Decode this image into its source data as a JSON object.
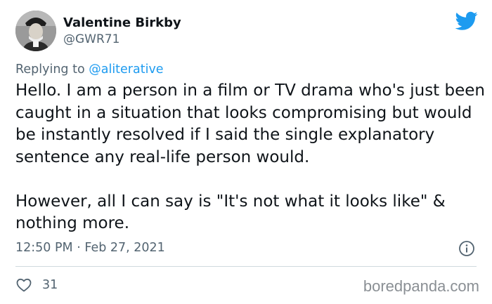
{
  "author": {
    "name": "Valentine Birkby",
    "handle": "@GWR71"
  },
  "reply": {
    "prefix": "Replying to ",
    "mention": "@aliterative"
  },
  "tweet": {
    "paragraphs": [
      "Hello. I am a person in a film or TV drama who's just been caught in a situation that looks compromising but would be instantly resolved if I said the single explanatory sentence any real-life person would.",
      "However, all I can say is \"It's not what it looks like\" & nothing more."
    ],
    "timestamp": "12:50 PM · Feb 27, 2021"
  },
  "engagement": {
    "likes": "31"
  },
  "watermark": "boredpanda.com",
  "colors": {
    "twitter_blue": "#1d9bf0",
    "secondary_text": "#536471",
    "divider": "#cfd9de"
  },
  "icons": [
    "twitter-bird-icon",
    "info-icon",
    "heart-icon"
  ]
}
